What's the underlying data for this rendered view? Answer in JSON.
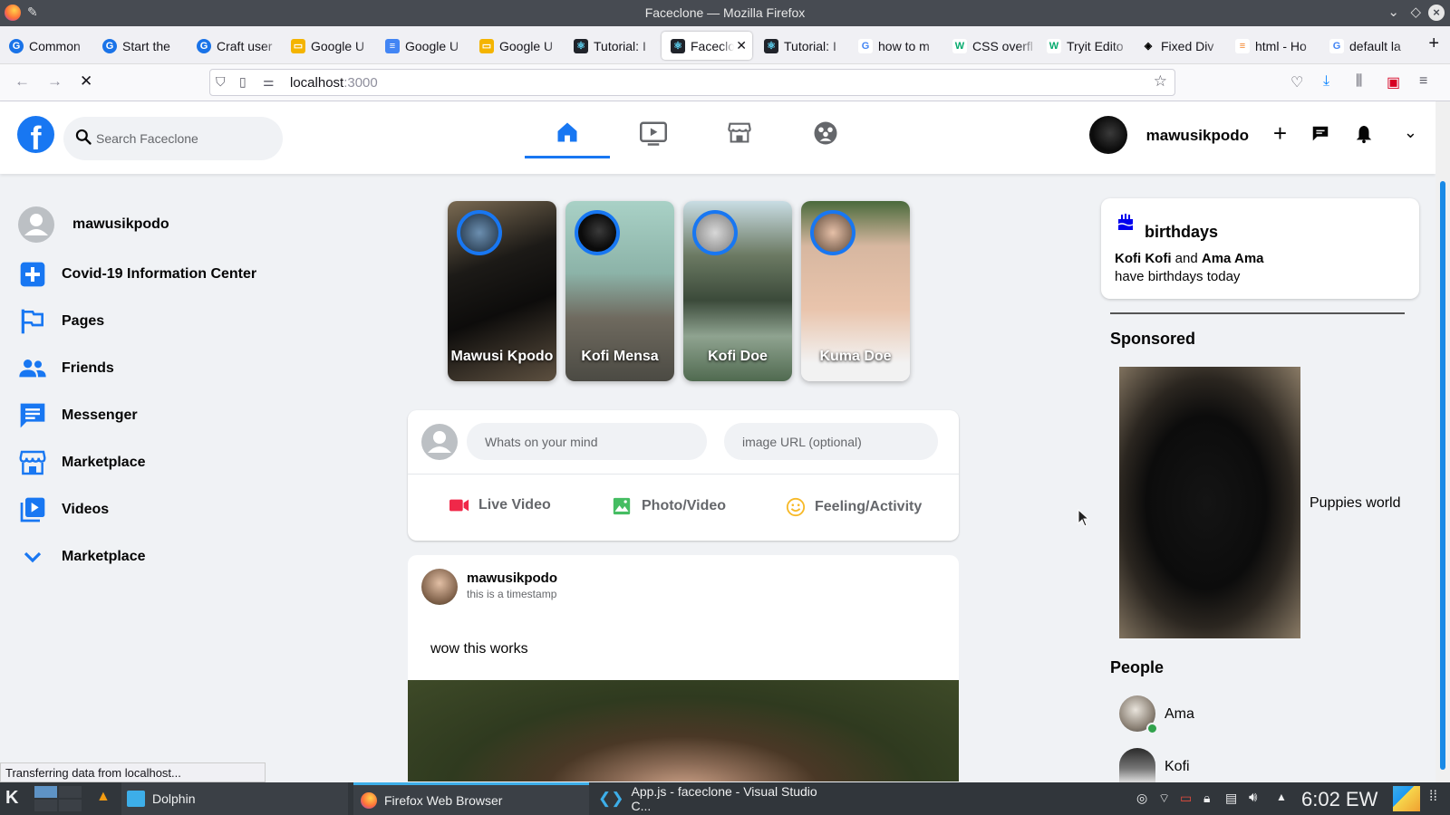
{
  "window": {
    "title": "Faceclone — Mozilla Firefox"
  },
  "tabs": [
    {
      "label": "Common",
      "icon": "grammarly-icon"
    },
    {
      "label": "Start the",
      "icon": "grammarly-icon"
    },
    {
      "label": "Craft user",
      "icon": "grammarly-icon"
    },
    {
      "label": "Google U",
      "icon": "google-slides-icon"
    },
    {
      "label": "Google U",
      "icon": "google-docs-icon"
    },
    {
      "label": "Google U",
      "icon": "google-slides-icon"
    },
    {
      "label": "Tutorial: I",
      "icon": "react-icon"
    },
    {
      "label": "Faceclo",
      "icon": "react-icon",
      "active": true
    },
    {
      "label": "Tutorial: I",
      "icon": "react-icon"
    },
    {
      "label": "how to m",
      "icon": "google-icon"
    },
    {
      "label": "CSS overfl",
      "icon": "w3schools-icon"
    },
    {
      "label": "Tryit Edito",
      "icon": "w3schools-icon"
    },
    {
      "label": "Fixed Div",
      "icon": "codepen-icon"
    },
    {
      "label": "html - Ho",
      "icon": "stackoverflow-icon"
    },
    {
      "label": "default la",
      "icon": "google-icon"
    }
  ],
  "browser": {
    "url_host": "localhost",
    "url_port": ":3000"
  },
  "header": {
    "search_placeholder": "Search Faceclone",
    "username": "mawusikpodo",
    "nav": [
      "home-icon",
      "video-icon",
      "marketplace-icon",
      "groups-icon"
    ]
  },
  "sidebar": {
    "profile_name": "mawusikpodo",
    "items": [
      {
        "label": "Covid-19 Information Center",
        "icon": "plus-box-icon"
      },
      {
        "label": "Pages",
        "icon": "flag-icon"
      },
      {
        "label": "Friends",
        "icon": "people-icon"
      },
      {
        "label": "Messenger",
        "icon": "chat-icon"
      },
      {
        "label": "Marketplace",
        "icon": "store-icon"
      },
      {
        "label": "Videos",
        "icon": "video-library-icon"
      },
      {
        "label": "Marketplace",
        "icon": "chevron-down-icon"
      }
    ]
  },
  "stories": [
    {
      "name": "Mawusi Kpodo"
    },
    {
      "name": "Kofi Mensa"
    },
    {
      "name": "Kofi Doe"
    },
    {
      "name": "Kuma Doe"
    }
  ],
  "composer": {
    "message_placeholder": "Whats on your mind",
    "image_placeholder": "image URL (optional)",
    "options": [
      {
        "label": "Live Video",
        "color": "#ff0000"
      },
      {
        "label": "Photo/Video",
        "color": "#2e8b57"
      },
      {
        "label": "Feeling/Activity",
        "color": "#e6a700"
      }
    ]
  },
  "post": {
    "author": "mawusikpodo",
    "timestamp": "this is a timestamp",
    "message": "wow this works"
  },
  "birthdays": {
    "title": "birthdays",
    "name1": "Kofi Kofi",
    "conj": "and",
    "name2": "Ama Ama",
    "line2": "have birthdays today"
  },
  "sponsored": {
    "title": "Sponsored",
    "ad_text": "Puppies world"
  },
  "people": {
    "title": "People",
    "list": [
      {
        "name": "Ama",
        "online": true
      },
      {
        "name": "Kofi",
        "online": false
      }
    ]
  },
  "status_message": "Transferring data from localhost...",
  "taskbar": {
    "apps": [
      {
        "label": "Dolphin"
      },
      {
        "label": "Firefox Web Browser"
      },
      {
        "label": "App.js - faceclone - Visual Studio C..."
      }
    ],
    "clock": "6:02 EW"
  },
  "colors": {
    "accent": "#1877f2",
    "online": "#31a24c"
  }
}
